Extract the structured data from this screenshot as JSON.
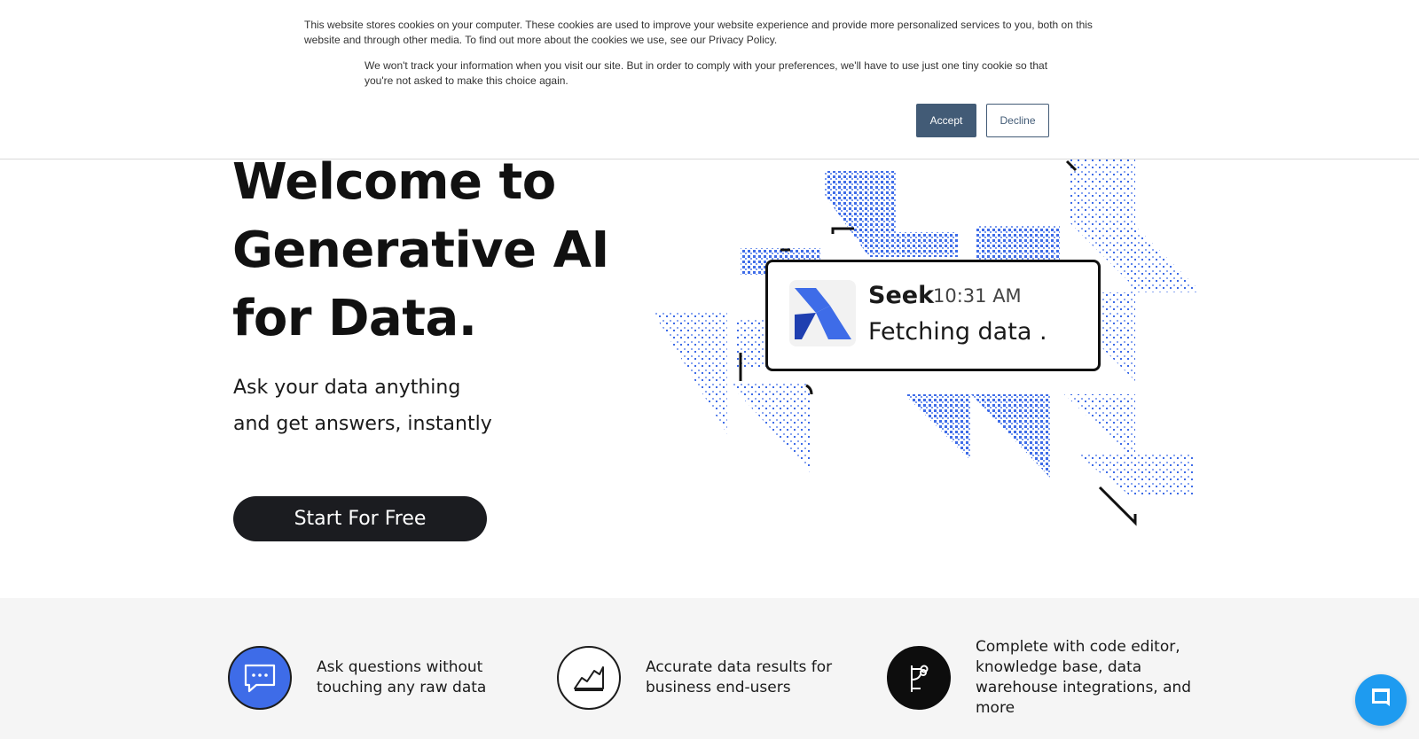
{
  "cookie_banner": {
    "text_primary": "This website stores cookies on your computer. These cookies are used to improve your website experience and provide more personalized services to you, both on this website and through other media. To find out more about the cookies we use, see our Privacy Policy.",
    "text_secondary": "We won't track your information when you visit our site. But in order to comply with your preferences, we'll have to use just one tiny cookie so that you're not asked to make this choice again.",
    "accept_label": "Accept",
    "decline_label": "Decline",
    "accept_color": "#425b76"
  },
  "hero": {
    "title_lines": [
      "Welcome to",
      "Generative AI",
      "for Data."
    ],
    "subtitle_lines": [
      "Ask your data anything",
      "and get answers, instantly"
    ],
    "cta_label": "Start For Free"
  },
  "illustration": {
    "card_name": "Seek",
    "card_time": "10:31 AM",
    "card_status": "Fetching data .",
    "accent_color": "#3e6ce8"
  },
  "features": [
    {
      "icon": "chat-bubble-icon",
      "text": "Ask questions without touching any raw data"
    },
    {
      "icon": "line-chart-icon",
      "text": "Accurate data results for business end-users"
    },
    {
      "icon": "branch-icon",
      "text": "Complete with code editor, knowledge base, data warehouse integrations, and more"
    }
  ],
  "chat_widget": {
    "icon": "chat-icon",
    "color": "#1e9bf0"
  }
}
